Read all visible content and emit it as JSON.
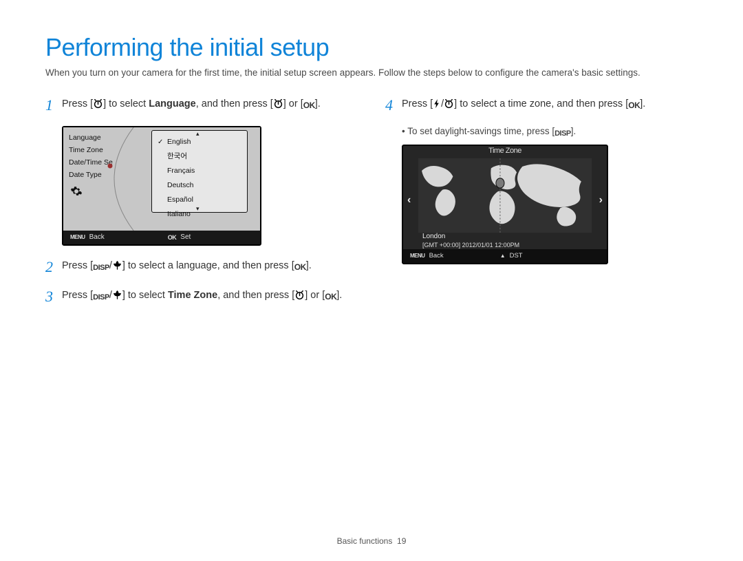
{
  "title": "Performing the initial setup",
  "intro": "When you turn on your camera for the first time, the initial setup screen appears. Follow the steps below to configure the camera's basic settings.",
  "steps": {
    "s1a": "Press [",
    "s1b": "] to select ",
    "s1bold": "Language",
    "s1c": ", and then press [",
    "s1d": "] or [",
    "s1e": "].",
    "s2a": "Press [",
    "s2b": "] to select a language, and then press [",
    "s2c": "].",
    "s3a": "Press [",
    "s3b": "] to select ",
    "s3bold": "Time Zone",
    "s3c": ", and then press [",
    "s3d": "] or [",
    "s3e": "].",
    "s4a": "Press [",
    "s4b": "] to select a time zone, and then press [",
    "s4c": "].",
    "s4sub_a": "To set daylight-savings time, press [",
    "s4sub_b": "]."
  },
  "nums": {
    "n1": "1",
    "n2": "2",
    "n3": "3",
    "n4": "4"
  },
  "lcd_lang": {
    "menu": [
      "Language",
      "Time Zone",
      "Date/Time Se",
      "Date Type"
    ],
    "options": [
      "English",
      "한국어",
      "Français",
      "Deutsch",
      "Español",
      "Italiano"
    ],
    "bar_back": "Back",
    "bar_set": "Set"
  },
  "lcd_tz": {
    "title": "Time Zone",
    "city": "London",
    "gmt": "[GMT +00:00]   2012/01/01   12:00PM",
    "bar_back": "Back",
    "bar_dst": "DST"
  },
  "labels": {
    "menu": "MENU",
    "ok": "OK",
    "disp": "DISP"
  },
  "footer": {
    "section": "Basic functions",
    "page": "19"
  }
}
